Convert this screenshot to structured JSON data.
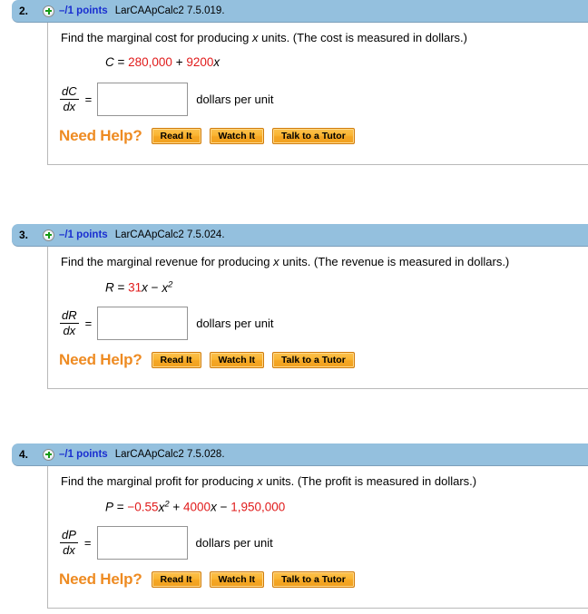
{
  "page": {
    "background": "#ffffff",
    "header_color": "#94c0de",
    "points_color": "#1a2fd0",
    "number_color": "#e01b1b",
    "help_color": "#ee8b22",
    "button_color": "#f5a623"
  },
  "help": {
    "label": "Need Help?",
    "buttons": [
      {
        "label": "Read It",
        "name": "read-it-button"
      },
      {
        "label": "Watch It",
        "name": "watch-it-button"
      },
      {
        "label": "Talk to a Tutor",
        "name": "talk-to-a-tutor-button"
      }
    ]
  },
  "questions": [
    {
      "number": "2.",
      "plus_icon": "plus-circle-icon",
      "points": "–/1 points",
      "code": "LarCAApCalc2 7.5.019.",
      "prompt_part1": "Find the marginal cost for producing ",
      "prompt_var": "x",
      "prompt_part2": " units. (The cost is measured in dollars.)",
      "formula": {
        "lhs": "C",
        "eq": " = ",
        "terms": [
          {
            "text": "280,000",
            "style": "num"
          },
          {
            "text": " + ",
            "style": "op"
          },
          {
            "text": "9200",
            "style": "num"
          },
          {
            "text": "x",
            "style": "var"
          }
        ]
      },
      "derivative_top": "dC",
      "derivative_bottom": "dx",
      "equals": "=",
      "answer_value": "",
      "answer_placeholder": "",
      "units": "dollars per unit"
    },
    {
      "number": "3.",
      "plus_icon": "plus-circle-icon",
      "points": "–/1 points",
      "code": "LarCAApCalc2 7.5.024.",
      "prompt_part1": "Find the marginal revenue for producing ",
      "prompt_var": "x",
      "prompt_part2": " units. (The revenue is measured in dollars.)",
      "formula": {
        "lhs": "R",
        "eq": " = ",
        "terms": [
          {
            "text": "31",
            "style": "num"
          },
          {
            "text": "x",
            "style": "var"
          },
          {
            "text": " − ",
            "style": "op"
          },
          {
            "text": "x",
            "style": "var",
            "sup": "2"
          }
        ]
      },
      "derivative_top": "dR",
      "derivative_bottom": "dx",
      "equals": "=",
      "answer_value": "",
      "answer_placeholder": "",
      "units": "dollars per unit"
    },
    {
      "number": "4.",
      "plus_icon": "plus-circle-icon",
      "points": "–/1 points",
      "code": "LarCAApCalc2 7.5.028.",
      "prompt_part1": "Find the marginal profit for producing ",
      "prompt_var": "x",
      "prompt_part2": " units. (The profit is measured in dollars.)",
      "formula": {
        "lhs": "P",
        "eq": " = ",
        "terms": [
          {
            "text": "−0.55",
            "style": "num"
          },
          {
            "text": "x",
            "style": "var",
            "sup": "2"
          },
          {
            "text": " + ",
            "style": "op"
          },
          {
            "text": "4000",
            "style": "num"
          },
          {
            "text": "x",
            "style": "var"
          },
          {
            "text": " − ",
            "style": "op"
          },
          {
            "text": "1,950,000",
            "style": "num"
          }
        ]
      },
      "derivative_top": "dP",
      "derivative_bottom": "dx",
      "equals": "=",
      "answer_value": "",
      "answer_placeholder": "",
      "units": "dollars per unit"
    }
  ],
  "layout": {
    "question_tops": [
      0,
      247,
      489
    ]
  }
}
